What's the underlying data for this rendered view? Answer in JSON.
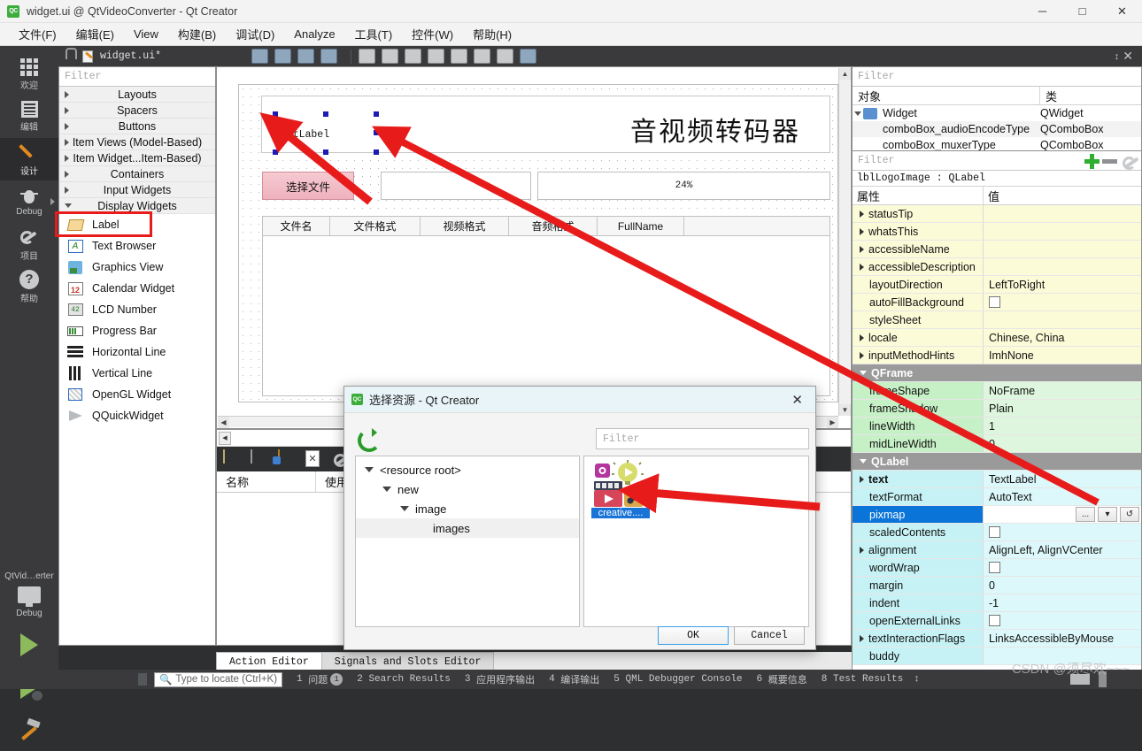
{
  "window": {
    "title": "widget.ui @ QtVideoConverter - Qt Creator",
    "logo_text": "QC",
    "minimize": "─",
    "maximize": "□",
    "close": "✕"
  },
  "menubar": [
    {
      "label": "文件(F)"
    },
    {
      "label": "编辑(E)"
    },
    {
      "label": "View"
    },
    {
      "label": "构建(B)"
    },
    {
      "label": "调试(D)"
    },
    {
      "label": "Analyze"
    },
    {
      "label": "工具(T)"
    },
    {
      "label": "控件(W)"
    },
    {
      "label": "帮助(H)"
    }
  ],
  "modebar": {
    "items": [
      {
        "label": "欢迎",
        "icon": "grid-icon",
        "active": false
      },
      {
        "label": "编辑",
        "icon": "document-icon",
        "active": false
      },
      {
        "label": "设计",
        "icon": "pencil-icon",
        "active": true
      },
      {
        "label": "Debug",
        "icon": "bug-icon",
        "active": false
      },
      {
        "label": "项目",
        "icon": "wrench-icon",
        "active": false
      },
      {
        "label": "帮助",
        "icon": "question-icon",
        "active": false
      }
    ],
    "kit_name": "QtVid…erter",
    "kit_config": "Debug",
    "run_button": "run-icon",
    "debug_button": "debug-run-icon",
    "build_button": "hammer-icon"
  },
  "widget_box": {
    "filter_placeholder": "Filter",
    "categories": [
      {
        "label": "Layouts",
        "open": false
      },
      {
        "label": "Spacers",
        "open": false
      },
      {
        "label": "Buttons",
        "open": false
      },
      {
        "label": "Item Views (Model-Based)",
        "open": false
      },
      {
        "label": "Item Widget...Item-Based)",
        "open": false
      },
      {
        "label": "Containers",
        "open": false
      },
      {
        "label": "Input Widgets",
        "open": false
      },
      {
        "label": "Display Widgets",
        "open": true
      }
    ],
    "items": [
      {
        "label": "Label",
        "icon": "label-icon",
        "highlighted": true
      },
      {
        "label": "Text Browser",
        "icon": "text-browser-icon"
      },
      {
        "label": "Graphics View",
        "icon": "graphics-view-icon"
      },
      {
        "label": "Calendar Widget",
        "icon": "calendar-icon"
      },
      {
        "label": "LCD Number",
        "icon": "lcd-icon"
      },
      {
        "label": "Progress Bar",
        "icon": "progress-bar-icon"
      },
      {
        "label": "Horizontal Line",
        "icon": "horizontal-line-icon"
      },
      {
        "label": "Vertical Line",
        "icon": "vertical-line-icon"
      },
      {
        "label": "OpenGL Widget",
        "icon": "opengl-icon"
      },
      {
        "label": "QQuickWidget",
        "icon": "qquick-icon"
      }
    ]
  },
  "editor_tab": {
    "filename": "widget.ui*",
    "lock_icon": "unlock-icon",
    "file_icon": "ui-file-icon",
    "split_icon": "split-icon",
    "close_icon": "close-icon"
  },
  "form": {
    "label_text": "TextLabel",
    "title_text": "音视频转码器",
    "choose_button": "选择文件",
    "path_value": "",
    "progress_text": "24%",
    "progress_value": 24,
    "table_headers": [
      "文件名",
      "文件格式",
      "视频格式",
      "音频格式",
      "FullName"
    ]
  },
  "resource_dock": {
    "columns": [
      "名称",
      "使用"
    ],
    "toolbar_icons": [
      "new-file-icon",
      "copy-file-icon",
      "add-file-icon",
      "remove-file-icon",
      "configure-icon"
    ]
  },
  "bottom_tabs": [
    {
      "label": "Action Editor",
      "active": true
    },
    {
      "label": "Signals and Slots Editor",
      "active": false
    }
  ],
  "object_inspector": {
    "filter_placeholder": "Filter",
    "columns": [
      "对象",
      "类"
    ],
    "rows": [
      {
        "name": "Widget",
        "class": "QWidget",
        "indent": 0,
        "icon": "widget-icon"
      },
      {
        "name": "comboBox_audioEncodeType",
        "class": "QComboBox",
        "indent": 1
      },
      {
        "name": "comboBox_muxerType",
        "class": "QComboBox",
        "indent": 1
      }
    ]
  },
  "property_editor": {
    "filter_placeholder": "Filter",
    "add_icon": "plus-icon",
    "remove_icon": "minus-icon",
    "configure_icon": "wrench-icon",
    "object_header": "lblLogoImage : QLabel",
    "columns": [
      "属性",
      "值"
    ],
    "rows": [
      {
        "name": "statusTip",
        "value": "",
        "group": "yellow",
        "expandable": true
      },
      {
        "name": "whatsThis",
        "value": "",
        "group": "yellow",
        "expandable": true
      },
      {
        "name": "accessibleName",
        "value": "",
        "group": "yellow",
        "expandable": true
      },
      {
        "name": "accessibleDescription",
        "value": "",
        "group": "yellow",
        "expandable": true
      },
      {
        "name": "layoutDirection",
        "value": "LeftToRight",
        "group": "yellow"
      },
      {
        "name": "autoFillBackground",
        "value": "",
        "group": "yellow",
        "checkbox": true
      },
      {
        "name": "styleSheet",
        "value": "",
        "group": "yellow"
      },
      {
        "name": "locale",
        "value": "Chinese, China",
        "group": "yellow",
        "expandable": true
      },
      {
        "name": "inputMethodHints",
        "value": "ImhNone",
        "group": "yellow",
        "expandable": true
      },
      {
        "name": "QFrame",
        "value": "",
        "group": "groupbar"
      },
      {
        "name": "frameShape",
        "value": "NoFrame",
        "group": "green"
      },
      {
        "name": "frameShadow",
        "value": "Plain",
        "group": "green"
      },
      {
        "name": "lineWidth",
        "value": "1",
        "group": "green"
      },
      {
        "name": "midLineWidth",
        "value": "0",
        "group": "green"
      },
      {
        "name": "QLabel",
        "value": "",
        "group": "groupbar"
      },
      {
        "name": "text",
        "value": "TextLabel",
        "group": "cyan",
        "expandable": true,
        "bold": true
      },
      {
        "name": "textFormat",
        "value": "AutoText",
        "group": "cyan"
      },
      {
        "name": "pixmap",
        "value": "",
        "group": "cyan",
        "selected": true,
        "editor": true
      },
      {
        "name": "scaledContents",
        "value": "",
        "group": "cyan",
        "checkbox": true
      },
      {
        "name": "alignment",
        "value": "AlignLeft, AlignVCenter",
        "group": "cyan",
        "expandable": true
      },
      {
        "name": "wordWrap",
        "value": "",
        "group": "cyan",
        "checkbox": true
      },
      {
        "name": "margin",
        "value": "0",
        "group": "cyan"
      },
      {
        "name": "indent",
        "value": "-1",
        "group": "cyan"
      },
      {
        "name": "openExternalLinks",
        "value": "",
        "group": "cyan",
        "checkbox": true
      },
      {
        "name": "textInteractionFlags",
        "value": "LinksAccessibleByMouse",
        "group": "cyan",
        "expandable": true
      },
      {
        "name": "buddy",
        "value": "",
        "group": "cyan"
      }
    ],
    "editor_buttons": [
      "...",
      "▾",
      "↺"
    ]
  },
  "dialog": {
    "logo_text": "QC",
    "title": "选择资源 - Qt Creator",
    "close_icon": "close-icon",
    "refresh_icon": "refresh-icon",
    "filter_placeholder": "Filter",
    "tree": [
      {
        "label": "<resource root>",
        "indent": 0,
        "expanded": true
      },
      {
        "label": "new",
        "indent": 1,
        "expanded": true
      },
      {
        "label": "image",
        "indent": 2,
        "expanded": true
      },
      {
        "label": "images",
        "indent": 3,
        "expanded": false,
        "selected": true
      }
    ],
    "grid_item": {
      "caption": "creative....",
      "icon": "creative-multimedia-icon"
    },
    "ok_label": "OK",
    "cancel_label": "Cancel"
  },
  "statusbar": {
    "locator_placeholder": "Type to locate (Ctrl+K)",
    "search_icon": "search-icon",
    "panes": [
      {
        "num": "1",
        "label": "问题",
        "badge": "1"
      },
      {
        "num": "2",
        "label": "Search Results",
        "badge": ""
      },
      {
        "num": "3",
        "label": "应用程序输出",
        "badge": ""
      },
      {
        "num": "4",
        "label": "编译输出",
        "badge": ""
      },
      {
        "num": "5",
        "label": "QML Debugger Console",
        "badge": ""
      },
      {
        "num": "6",
        "label": "概要信息",
        "badge": ""
      },
      {
        "num": "8",
        "label": "Test Results",
        "badge": ""
      }
    ]
  },
  "watermark": "CSDN @须尽欢~~~"
}
